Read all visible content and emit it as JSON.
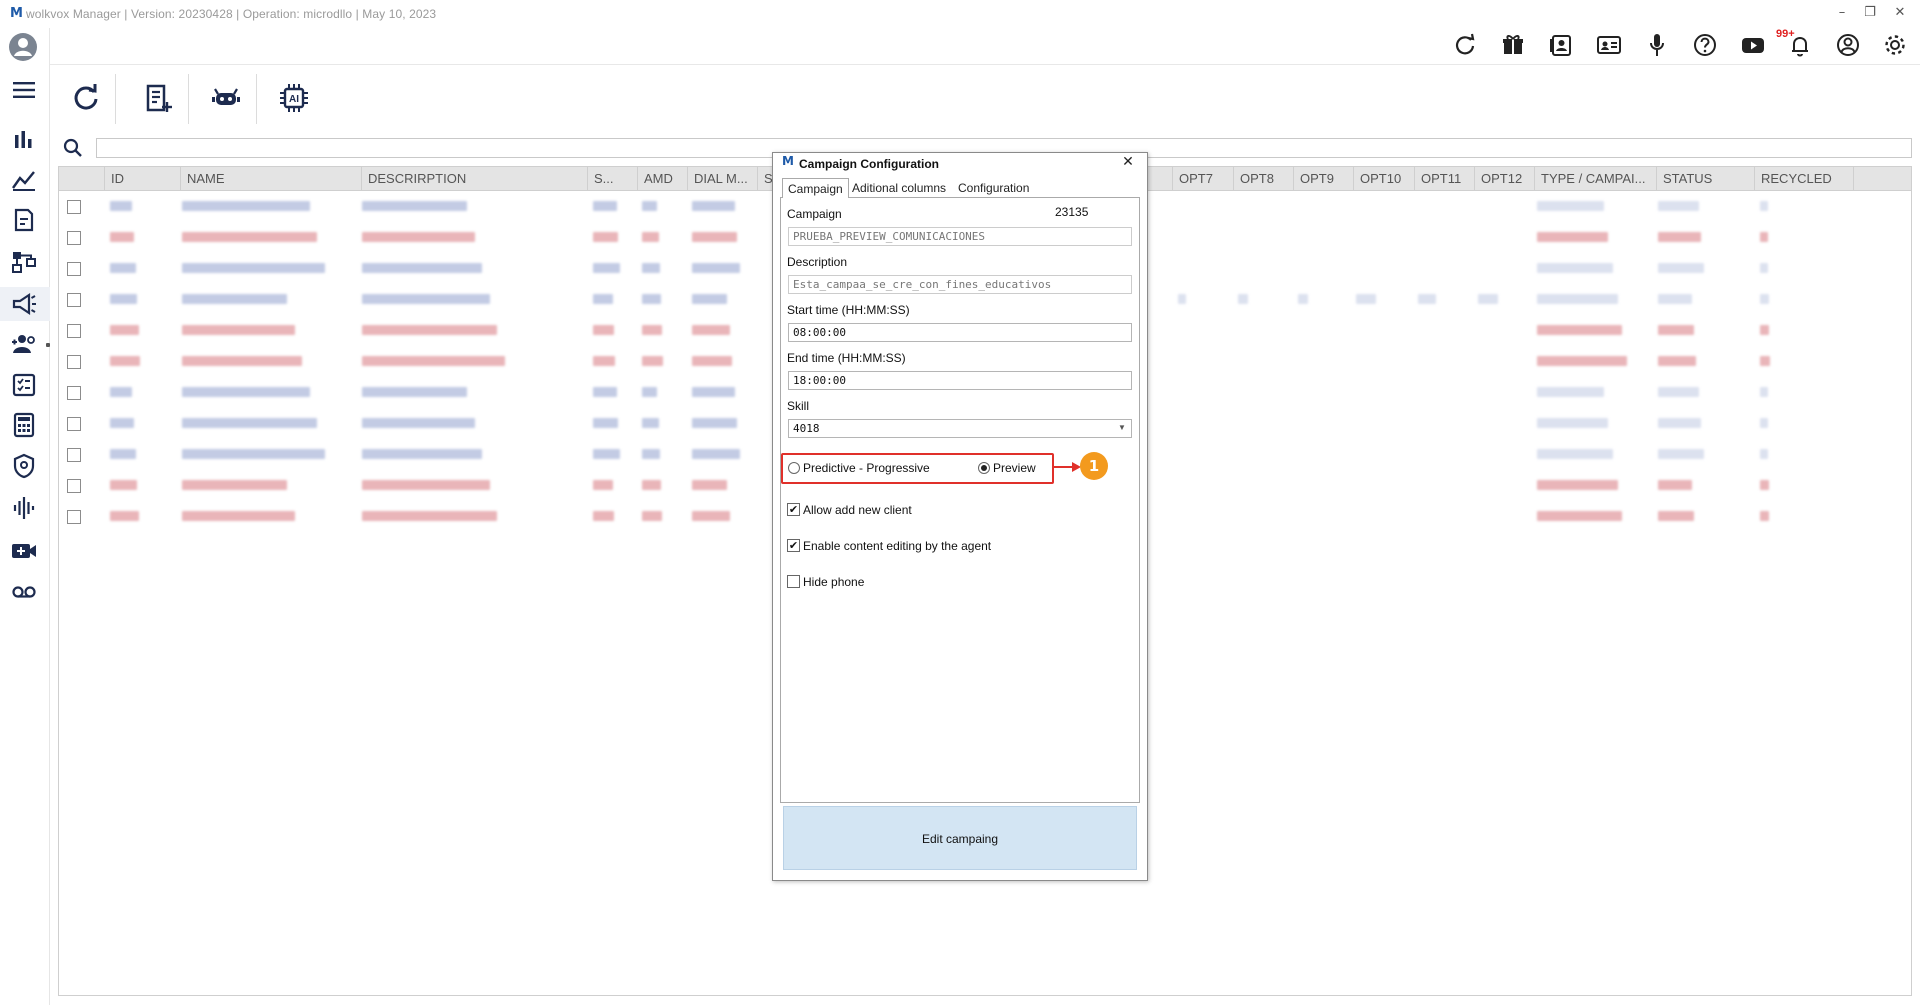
{
  "window": {
    "logo": "M",
    "title": "wolkvox Manager  | Version: 20230428 |  Operation: microdllo  |  May 10, 2023",
    "minimize": "–",
    "restore": "❐",
    "close": "✕"
  },
  "top_toolbar": {
    "icons": [
      "refresh-icon",
      "gift-icon",
      "contacts-book-icon",
      "id-card-icon",
      "microphone-icon",
      "help-icon",
      "youtube-icon",
      "bell-icon",
      "user-circle-icon",
      "gear-icon"
    ],
    "notification_badge": "99+"
  },
  "sidebar": {
    "items": [
      "menu-icon",
      "bar-chart-icon",
      "line-chart-icon",
      "report-icon",
      "flow-icon",
      "megaphone-icon",
      "users-icon",
      "checklist-icon",
      "calculator-icon",
      "shield-icon",
      "audio-wave-icon",
      "video-add-icon",
      "voicemail-icon"
    ],
    "active": "megaphone-icon"
  },
  "toolbar": {
    "buttons": [
      "refresh-icon",
      "add-list-icon",
      "bot-icon",
      "ai-chip-icon"
    ],
    "ai_label": "AI"
  },
  "search": {
    "value": "",
    "placeholder": ""
  },
  "grid": {
    "columns": [
      "ID",
      "NAME",
      "DESCRIRPTION",
      "S...",
      "AMD",
      "DIAL M...",
      "S",
      "OPT7",
      "OPT8",
      "OPT9",
      "OPT10",
      "OPT11",
      "OPT12",
      "TYPE / CAMPAI...",
      "STATUS",
      "RECYCLED"
    ],
    "row_count": 11
  },
  "dialog": {
    "logo": "M",
    "title": "Campaign Configuration",
    "close": "✕",
    "tabs": [
      "Campaign",
      "Aditional columns",
      "Configuration"
    ],
    "active_tab": "Campaign",
    "campaign_label": "Campaign",
    "campaign_id": "23135",
    "campaign_name": "PRUEBA_PREVIEW_COMUNICACIONES",
    "description_label": "Description",
    "description_value": "Esta_campaa_se_cre_con_fines_educativos",
    "start_label": "Start time (HH:MM:SS)",
    "start_value": "08:00:00",
    "end_label": "End time (HH:MM:SS)",
    "end_value": "18:00:00",
    "skill_label": "Skill",
    "skill_value": "4018",
    "mode_options": [
      "Predictive - Progressive",
      "Preview"
    ],
    "mode_selected": "Preview",
    "allow_new_client": "Allow add new client",
    "allow_new_client_checked": true,
    "enable_editing": "Enable content editing by the agent",
    "enable_editing_checked": true,
    "hide_phone": "Hide phone",
    "hide_phone_checked": false,
    "edit_button": "Edit campaing",
    "check_mark": "✔"
  },
  "callout": {
    "number": "1",
    "color": "#f39a1e",
    "highlight_color": "#e0302a"
  }
}
